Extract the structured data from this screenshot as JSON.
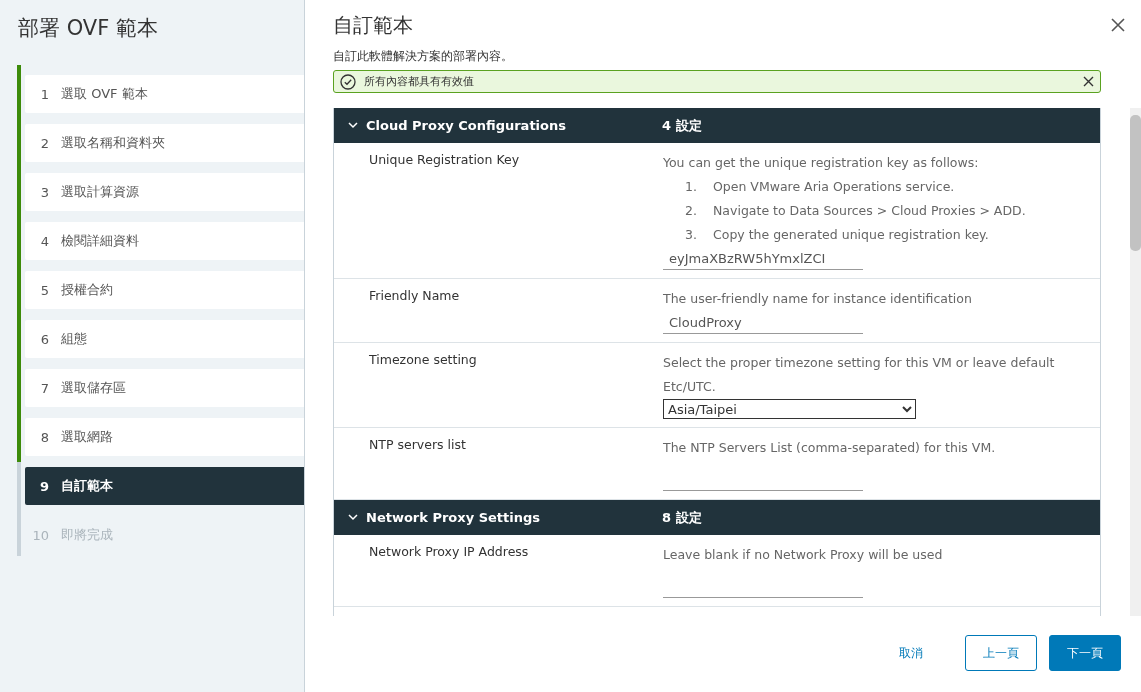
{
  "sidebar": {
    "title": "部署 OVF 範本",
    "steps": [
      {
        "number": "1",
        "label": "選取 OVF 範本",
        "completed": true,
        "disabled": false,
        "selected": false
      },
      {
        "number": "2",
        "label": "選取名稱和資料夾",
        "completed": true,
        "disabled": false,
        "selected": false
      },
      {
        "number": "3",
        "label": "選取計算資源",
        "completed": true,
        "disabled": false,
        "selected": false
      },
      {
        "number": "4",
        "label": "檢閱詳細資料",
        "completed": true,
        "disabled": false,
        "selected": false
      },
      {
        "number": "5",
        "label": "授權合約",
        "completed": true,
        "disabled": false,
        "selected": false
      },
      {
        "number": "6",
        "label": "組態",
        "completed": true,
        "disabled": false,
        "selected": false
      },
      {
        "number": "7",
        "label": "選取儲存區",
        "completed": true,
        "disabled": false,
        "selected": false
      },
      {
        "number": "8",
        "label": "選取網路",
        "completed": true,
        "disabled": false,
        "selected": false
      },
      {
        "number": "9",
        "label": "自訂範本",
        "completed": false,
        "disabled": false,
        "selected": true
      },
      {
        "number": "10",
        "label": "即將完成",
        "completed": false,
        "disabled": true,
        "selected": false
      }
    ]
  },
  "page": {
    "title": "自訂範本",
    "subtitle": "自訂此軟體解決方案的部署內容。",
    "alert": {
      "text": "所有內容都具有有效值"
    }
  },
  "sections": [
    {
      "title": "Cloud Proxy Configurations",
      "count": "4 設定",
      "expanded": true,
      "rows": [
        {
          "label": "Unique Registration Key",
          "description": "You can get the unique registration key as follows:",
          "steps": [
            {
              "number": "1.",
              "text": "Open VMware Aria Operations service."
            },
            {
              "number": "2.",
              "text": "Navigate to Data Sources > Cloud Proxies > ADD."
            },
            {
              "number": "3.",
              "text": "Copy the generated unique registration key."
            }
          ],
          "field": {
            "kind": "text",
            "value": "eyJmaXBzRW5hYmxlZCI"
          }
        },
        {
          "label": "Friendly Name",
          "description": "The user-friendly name for instance identification",
          "field": {
            "kind": "text",
            "value": "CloudProxy"
          }
        },
        {
          "label": "Timezone setting",
          "description": "Select the proper timezone setting for this VM or leave default Etc/UTC.",
          "field": {
            "kind": "select",
            "value": "Asia/Taipei"
          }
        },
        {
          "label": "NTP servers list",
          "description": "The NTP Servers List (comma-separated) for this VM.",
          "field": {
            "kind": "text"
          }
        }
      ]
    },
    {
      "title": "Network Proxy Settings",
      "count": "8 設定",
      "expanded": true,
      "rows": [
        {
          "label": "Network Proxy IP Address",
          "description": "Leave blank if no Network Proxy will be used",
          "field": {
            "kind": "text"
          }
        }
      ]
    }
  ],
  "footer": {
    "cancel": "取消",
    "back": "上一頁",
    "next": "下一頁"
  }
}
